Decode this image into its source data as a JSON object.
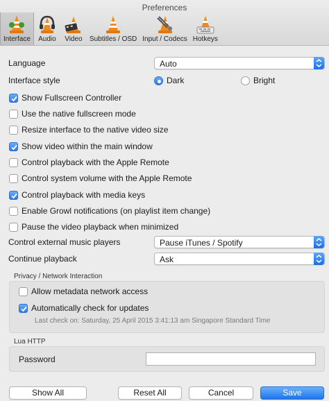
{
  "window": {
    "title": "Preferences"
  },
  "tabs": [
    {
      "label": "Interface",
      "icon": "interface-cone-icon",
      "active": true
    },
    {
      "label": "Audio",
      "icon": "audio-headphones-icon",
      "active": false
    },
    {
      "label": "Video",
      "icon": "video-cone-icon",
      "active": false
    },
    {
      "label": "Subtitles / OSD",
      "icon": "subtitles-cone-icon",
      "active": false
    },
    {
      "label": "Input / Codecs",
      "icon": "codecs-cone-icon",
      "active": false
    },
    {
      "label": "Hotkeys",
      "icon": "hotkeys-cone-icon",
      "active": false
    }
  ],
  "language": {
    "label": "Language",
    "value": "Auto"
  },
  "interface_style": {
    "label": "Interface style",
    "dark": "Dark",
    "bright": "Bright",
    "selected": "dark"
  },
  "options": [
    {
      "label": "Show Fullscreen Controller",
      "checked": true
    },
    {
      "label": "Use the native fullscreen mode",
      "checked": false
    },
    {
      "label": "Resize interface to the native video size",
      "checked": false
    },
    {
      "label": "Show video within the main window",
      "checked": true
    },
    {
      "label": "Control playback with the Apple Remote",
      "checked": false
    },
    {
      "label": "Control system volume with the Apple Remote",
      "checked": false
    },
    {
      "label": "Control playback with media keys",
      "checked": true
    },
    {
      "label": "Enable Growl notifications (on playlist item change)",
      "checked": false
    },
    {
      "label": "Pause the video playback when minimized",
      "checked": false
    }
  ],
  "music_players": {
    "label": "Control external music players",
    "value": "Pause iTunes / Spotify"
  },
  "continue_playback": {
    "label": "Continue playback",
    "value": "Ask"
  },
  "privacy": {
    "title": "Privacy / Network Interaction",
    "metadata": {
      "label": "Allow metadata network access",
      "checked": false
    },
    "updates": {
      "label": "Automatically check for updates",
      "checked": true
    },
    "last_check": "Last check on: Saturday, 25 April 2015 3:41:13 am Singapore Standard Time"
  },
  "lua": {
    "title": "Lua HTTP",
    "password_label": "Password",
    "password_value": ""
  },
  "buttons": {
    "show_all": "Show All",
    "reset_all": "Reset All",
    "cancel": "Cancel",
    "save": "Save"
  },
  "colors": {
    "accent": "#2a7ae8",
    "background": "#ececec"
  }
}
